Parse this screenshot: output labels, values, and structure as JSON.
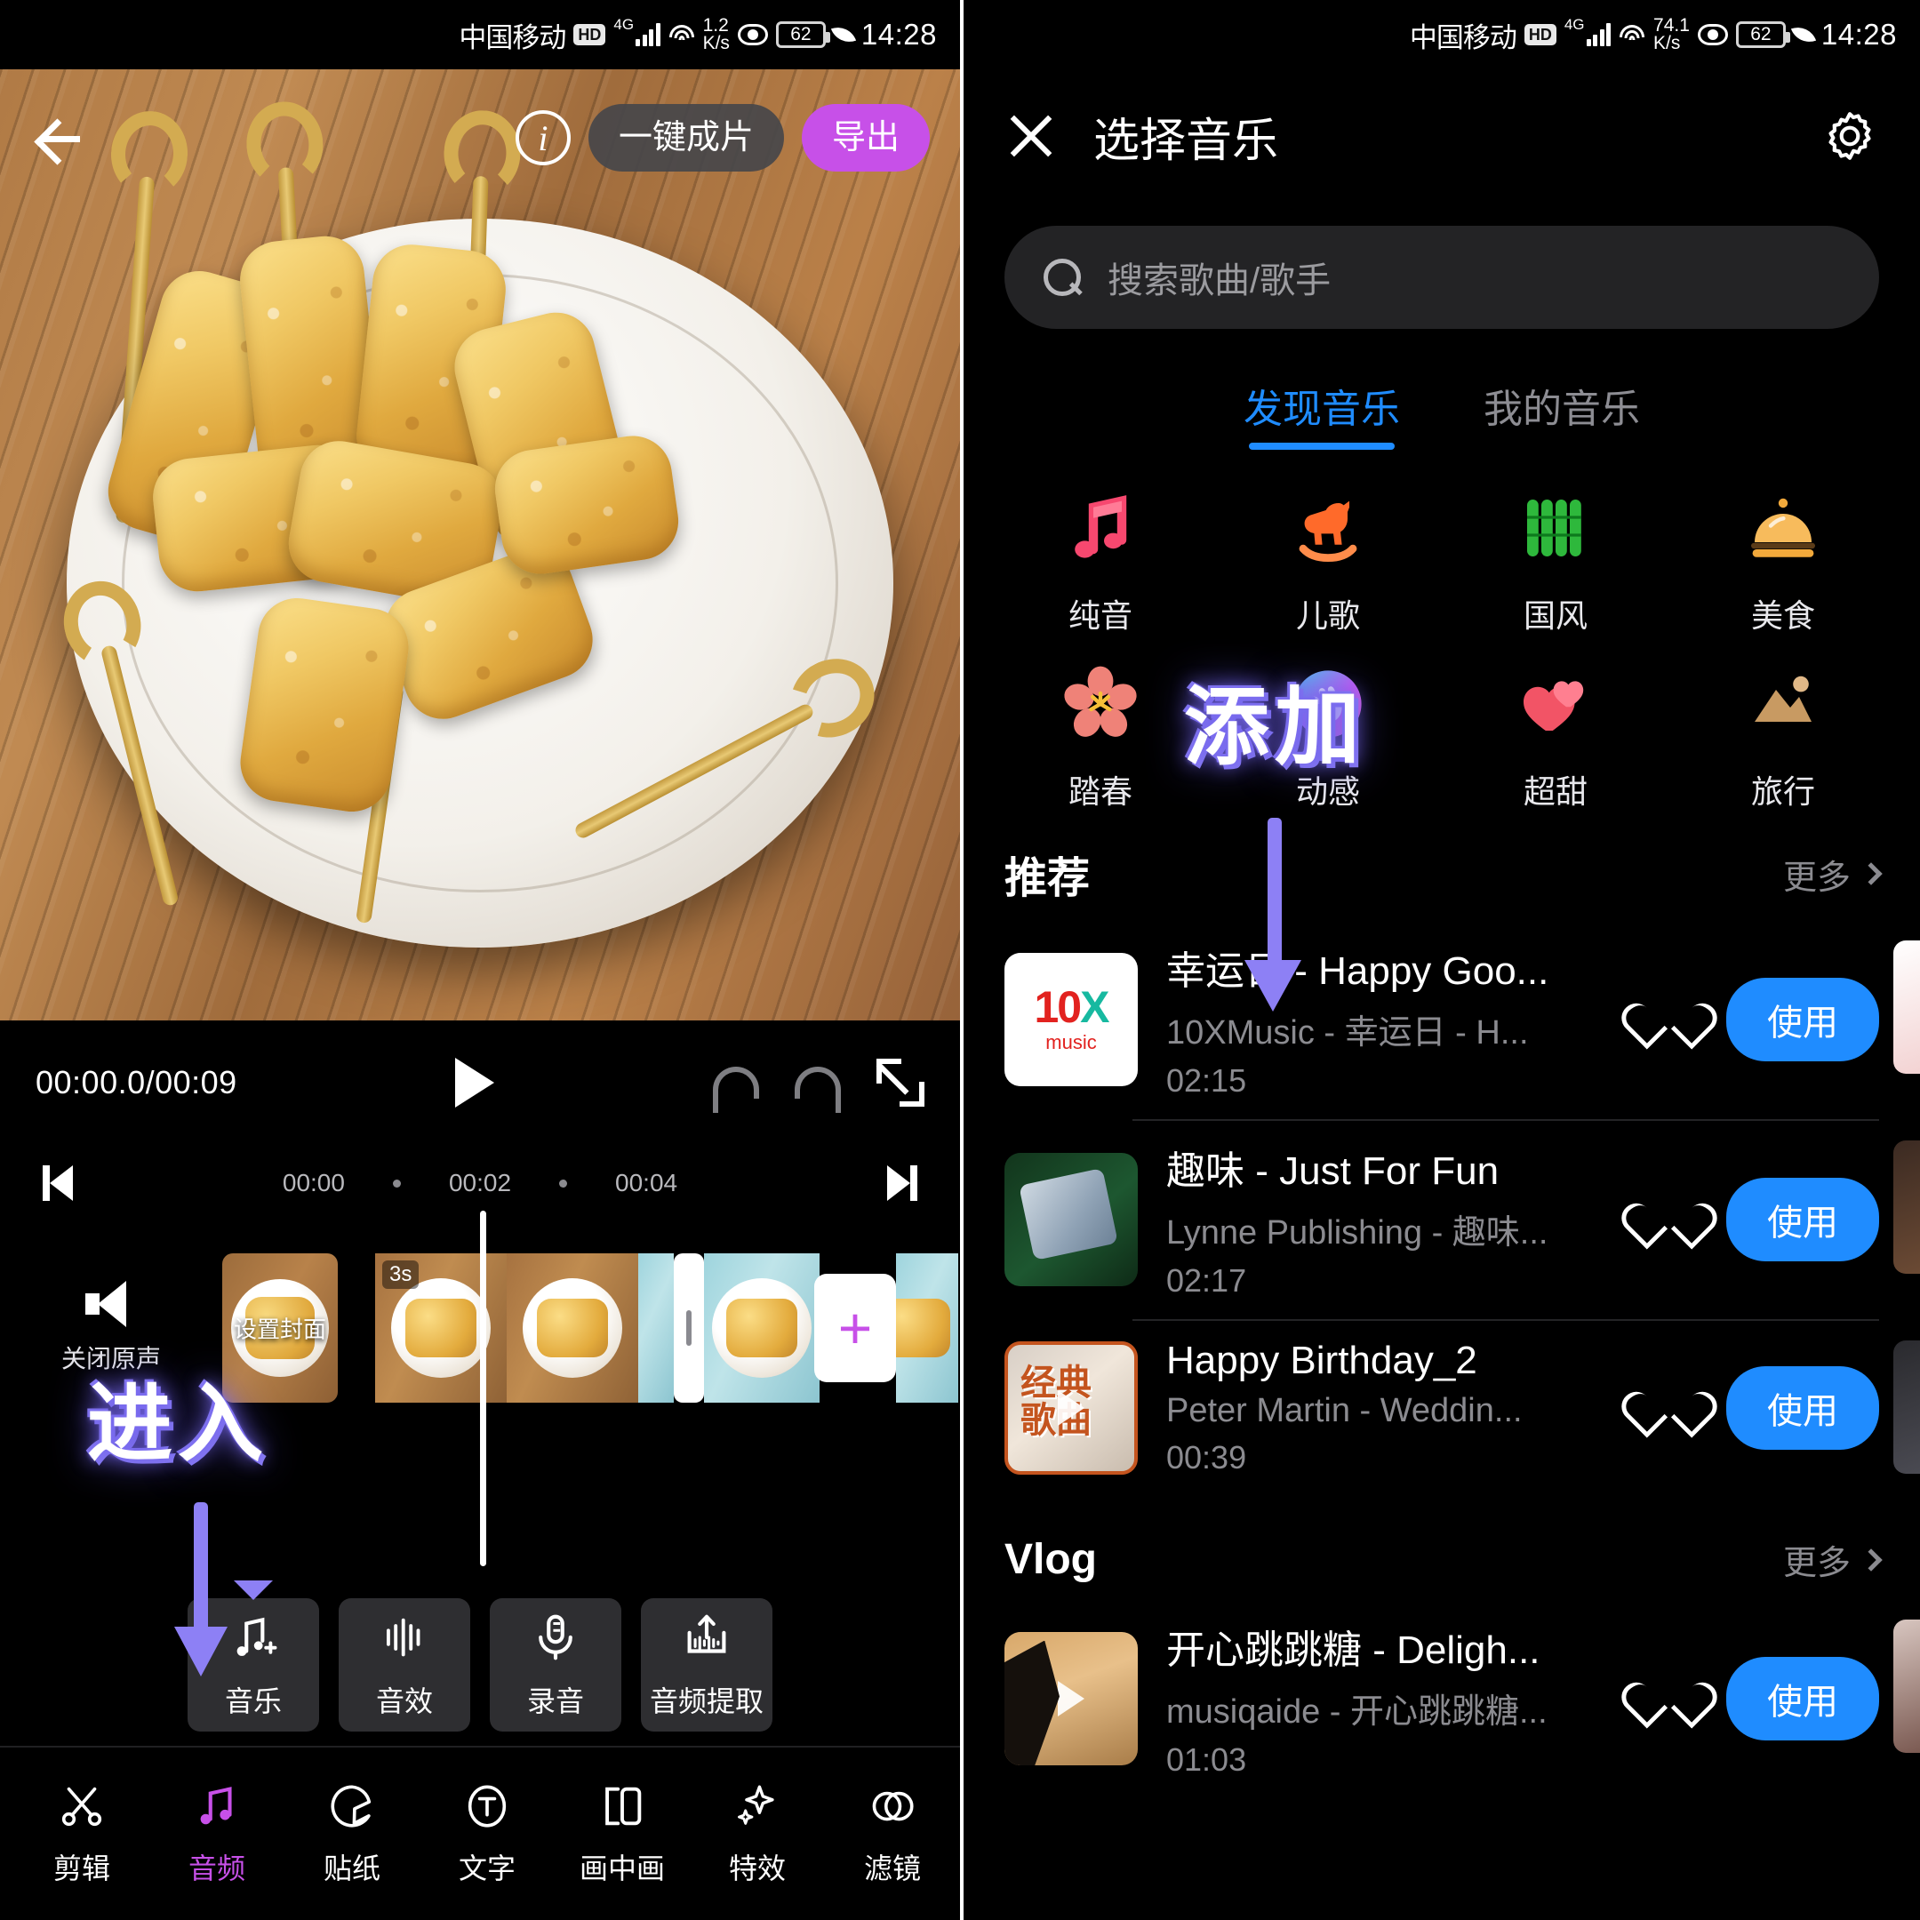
{
  "status_bar": {
    "carrier": "中国移动",
    "hd_badge": "HD",
    "network_type": "4G",
    "net_speed_left": "1.2",
    "net_speed_right": "74.1",
    "speed_unit": "K/s",
    "battery": "62",
    "time": "14:28"
  },
  "editor": {
    "top": {
      "back_icon": "back-arrow-icon",
      "info_icon": "info-icon",
      "auto_edit_label": "一键成片",
      "export_label": "导出"
    },
    "player": {
      "timecode": "00:00.0/00:09",
      "play_icon": "play-icon",
      "undo_icon": "undo-icon",
      "redo_icon": "redo-icon",
      "fullscreen_icon": "fullscreen-icon"
    },
    "ruler": {
      "skip_start_icon": "skip-to-start-icon",
      "skip_end_icon": "skip-to-end-icon",
      "ticks": [
        "00:00",
        "00:02",
        "00:04"
      ]
    },
    "track": {
      "mute_icon": "speaker-icon",
      "mute_label": "关闭原声",
      "cover_label": "设置封面",
      "clip_duration_badge": "3s",
      "add_clip_label": "+"
    },
    "audio_tools": [
      {
        "label": "音乐",
        "icon": "music-note-plus-icon",
        "selected": true
      },
      {
        "label": "音效",
        "icon": "sound-effect-icon",
        "selected": false
      },
      {
        "label": "录音",
        "icon": "microphone-icon",
        "selected": false
      },
      {
        "label": "音频提取",
        "icon": "audio-extract-icon",
        "selected": false
      }
    ],
    "bottom_nav": [
      {
        "label": "剪辑",
        "icon": "scissors-icon",
        "active": false
      },
      {
        "label": "音频",
        "icon": "music-note-icon",
        "active": true
      },
      {
        "label": "贴纸",
        "icon": "sticker-icon",
        "active": false
      },
      {
        "label": "文字",
        "icon": "text-icon",
        "active": false
      },
      {
        "label": "画中画",
        "icon": "picture-in-picture-icon",
        "active": false
      },
      {
        "label": "特效",
        "icon": "effects-icon",
        "active": false
      },
      {
        "label": "滤镜",
        "icon": "filter-icon",
        "active": false
      }
    ],
    "annotation": {
      "label": "进入",
      "arrow_icon": "down-arrow-annotation"
    }
  },
  "music_picker": {
    "close_icon": "close-icon",
    "title": "选择音乐",
    "settings_icon": "gear-icon",
    "search": {
      "icon": "search-icon",
      "placeholder": "搜索歌曲/歌手"
    },
    "tabs": [
      {
        "label": "发现音乐",
        "active": true
      },
      {
        "label": "我的音乐",
        "active": false
      }
    ],
    "categories": [
      {
        "label": "纯音",
        "icon": "music-note-icon",
        "color": "#f7486f"
      },
      {
        "label": "儿歌",
        "icon": "rocking-horse-icon",
        "color": "#ff6a2a"
      },
      {
        "label": "国风",
        "icon": "bamboo-icon",
        "color": "#2eb83c"
      },
      {
        "label": "美食",
        "icon": "food-cloche-icon",
        "color": "#f2a93b"
      },
      {
        "label": "踏春",
        "icon": "blossom-icon",
        "color": "#ef8278"
      },
      {
        "label": "动感",
        "icon": "dance-hands-icon",
        "color": "#e055d8"
      },
      {
        "label": "超甜",
        "icon": "hearts-icon",
        "color": "#f25466"
      },
      {
        "label": "旅行",
        "icon": "travel-icon",
        "color": "#c89a62"
      }
    ],
    "sections": [
      {
        "title": "推荐",
        "more_label": "更多",
        "songs": [
          {
            "title": "幸运日 - Happy Goo...",
            "artist": "10XMusic - 幸运日 - H...",
            "duration": "02:15",
            "use_label": "使用",
            "thumb": "t10x"
          },
          {
            "title": "趣味 - Just For Fun",
            "artist": "Lynne Publishing - 趣味...",
            "duration": "02:17",
            "use_label": "使用",
            "thumb": "t-fun"
          },
          {
            "title": "Happy Birthday_2",
            "artist": "Peter Martin - Weddin...",
            "duration": "00:39",
            "use_label": "使用",
            "thumb": "t-bday",
            "thumb_text": "经典\n歌曲"
          }
        ]
      },
      {
        "title": "Vlog",
        "more_label": "更多",
        "songs": [
          {
            "title": "开心跳跳糖 - Deligh...",
            "artist": "musiqaide - 开心跳跳糖...",
            "duration": "01:03",
            "use_label": "使用",
            "thumb": "t-vlog"
          }
        ]
      }
    ],
    "annotation": {
      "label": "添加",
      "arrow_icon": "down-arrow-annotation"
    }
  },
  "theme": {
    "accent_blue": "#1f8cff",
    "accent_purple": "#c750e8",
    "annotation_purple": "#8d80f5",
    "background": "#000000"
  }
}
